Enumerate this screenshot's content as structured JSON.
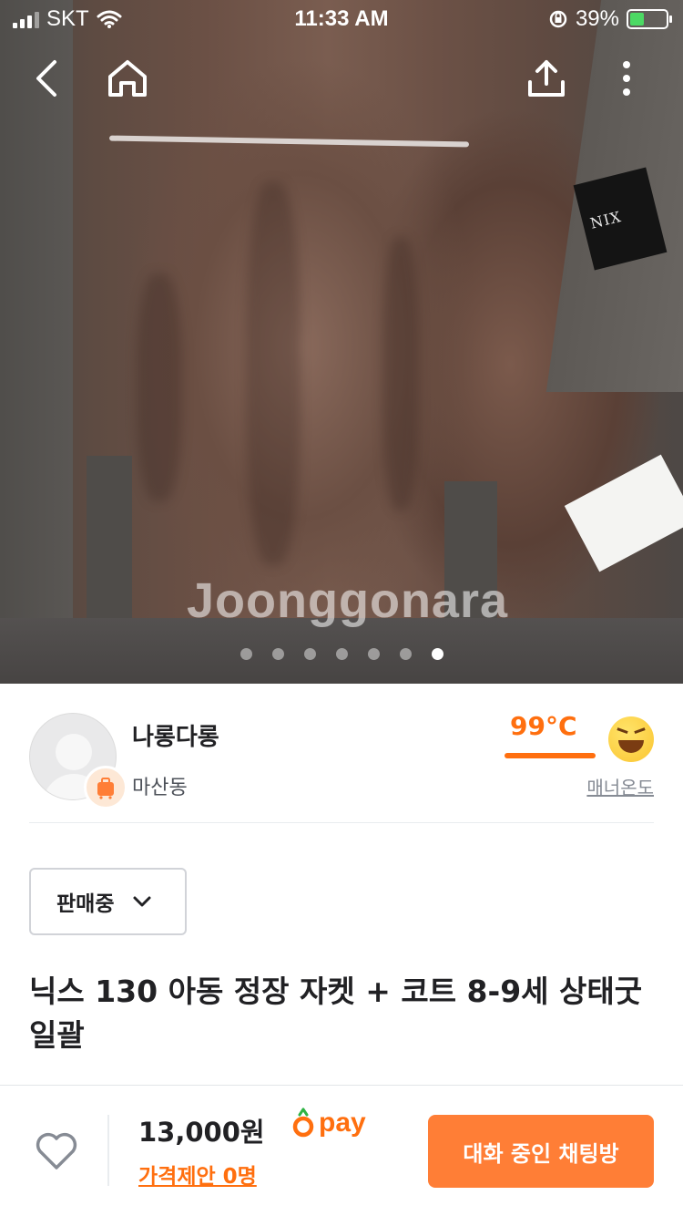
{
  "status_bar": {
    "carrier": "SKT",
    "time": "11:33 AM",
    "battery": "39%",
    "battery_level": 0.39
  },
  "nav": {
    "back_icon": "chevron-left-icon",
    "home_icon": "home-icon",
    "share_icon": "share-icon",
    "more_icon": "more-vertical-icon"
  },
  "photo": {
    "watermark": "Joonggonara",
    "label_text": "NIX",
    "dots_total": 7,
    "dots_active_index": 6
  },
  "seller": {
    "name": "나롱다롱",
    "location": "마산동",
    "temperature": "99°C",
    "manner_label": "매너온도"
  },
  "sale_status": {
    "label": "판매중"
  },
  "product": {
    "title": "닉스 130 아동 정장 자켓 + 코트 8-9세 상태굿 일괄"
  },
  "bottom_bar": {
    "price": "13,000원",
    "pay_label": "pay",
    "offer_label": "가격제안 0명",
    "chat_button": "대화 중인 채팅방"
  },
  "colors": {
    "accent": "#ff6f0f",
    "button": "#ff7e36"
  }
}
